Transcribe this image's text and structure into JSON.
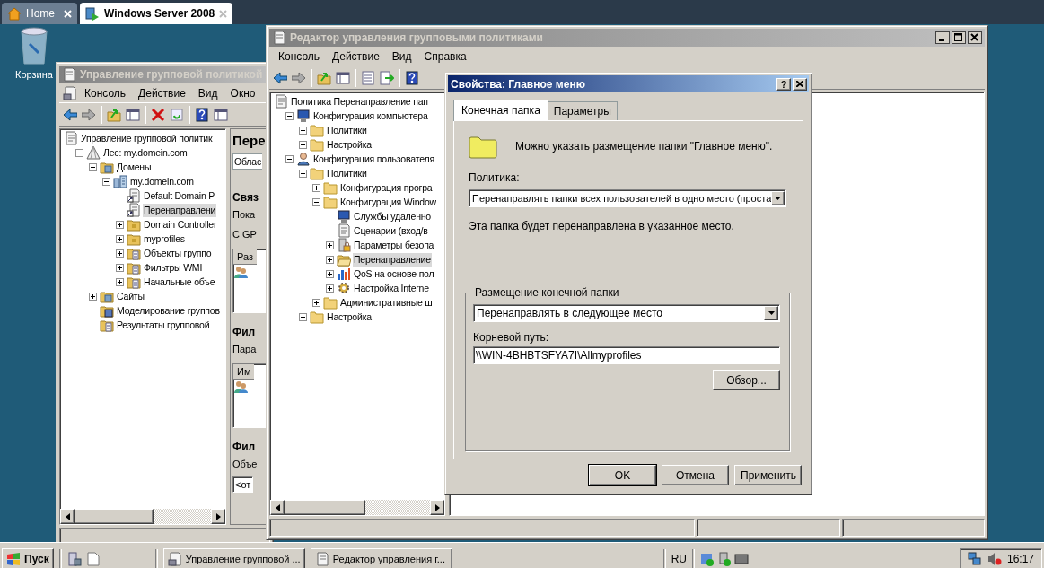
{
  "browser_tabs": [
    {
      "label": "Home",
      "selected": false
    },
    {
      "label": "Windows Server 2008",
      "selected": true
    }
  ],
  "desktop_icons": [
    {
      "label": "Корзина"
    }
  ],
  "gpmc_window": {
    "title": "Управление групповой политикой",
    "active": false,
    "menu": [
      "Консоль",
      "Действие",
      "Вид",
      "Окно"
    ],
    "tree": [
      {
        "label": "Управление групповой политик",
        "kind": "console",
        "selected": false,
        "children": [
          {
            "label": "Лес: my.domein.com",
            "kind": "forest",
            "expanded": true,
            "selected": false,
            "children": [
              {
                "label": "Домены",
                "kind": "domains",
                "expanded": true,
                "selected": false,
                "children": [
                  {
                    "label": "my.domein.com",
                    "kind": "domain",
                    "expanded": true,
                    "selected": false,
                    "children": [
                      {
                        "label": "Default Domain P",
                        "kind": "link",
                        "selected": false
                      },
                      {
                        "label": "Перенаправлени",
                        "kind": "link",
                        "selected": true
                      },
                      {
                        "label": "Domain Controller",
                        "kind": "ou",
                        "expanded": false,
                        "selected": false
                      },
                      {
                        "label": "myprofiles",
                        "kind": "ou",
                        "expanded": false,
                        "selected": false
                      },
                      {
                        "label": "Объекты группо",
                        "kind": "folder-doc",
                        "expanded": false,
                        "selected": false
                      },
                      {
                        "label": "Фильтры WMI",
                        "kind": "folder-doc",
                        "expanded": false,
                        "selected": false
                      },
                      {
                        "label": "Начальные объе",
                        "kind": "folder-doc",
                        "expanded": false,
                        "selected": false
                      }
                    ]
                  }
                ]
              },
              {
                "label": "Сайты",
                "kind": "domains",
                "expanded": false,
                "selected": false
              },
              {
                "label": "Моделирование группов",
                "kind": "modeling",
                "selected": false
              },
              {
                "label": "Результаты групповой",
                "kind": "folder-doc",
                "selected": false
              }
            ]
          }
        ]
      }
    ],
    "details": [
      {
        "kind": "title",
        "text": "Пере"
      },
      {
        "kind": "tab",
        "text": "Облас"
      },
      {
        "kind": "bold",
        "text": "Связ"
      },
      {
        "kind": "text",
        "text": "Пока"
      },
      {
        "kind": "text",
        "text": "С GP"
      },
      {
        "kind": "list",
        "text": "Раз"
      },
      {
        "kind": "bold",
        "text": "Фил"
      },
      {
        "kind": "text",
        "text": "Пара"
      },
      {
        "kind": "list",
        "text": "Им"
      },
      {
        "kind": "bold",
        "text": "Фил"
      },
      {
        "kind": "text",
        "text": "Объе"
      },
      {
        "kind": "field",
        "text": "<от"
      }
    ]
  },
  "editor_window": {
    "title": "Редактор управления групповыми политиками",
    "active": false,
    "menu": [
      "Консоль",
      "Действие",
      "Вид",
      "Справка"
    ],
    "tree": [
      {
        "label": "Политика Перенаправление пап",
        "kind": "console",
        "selected": false,
        "children": [
          {
            "label": "Конфигурация компьютера",
            "kind": "computer",
            "expanded": true,
            "selected": false,
            "children": [
              {
                "label": "Политики",
                "kind": "folder",
                "expanded": false,
                "selected": false
              },
              {
                "label": "Настройка",
                "kind": "folder",
                "expanded": false,
                "selected": false
              }
            ]
          },
          {
            "label": "Конфигурация пользователя",
            "kind": "user",
            "expanded": true,
            "selected": false,
            "children": [
              {
                "label": "Политики",
                "kind": "folder",
                "expanded": true,
                "selected": false,
                "children": [
                  {
                    "label": "Конфигурация програ",
                    "kind": "folder",
                    "expanded": false,
                    "selected": false
                  },
                  {
                    "label": "Конфигурация Window",
                    "kind": "folder",
                    "expanded": true,
                    "selected": false,
                    "children": [
                      {
                        "label": "Службы удаленно",
                        "kind": "computer",
                        "selected": false
                      },
                      {
                        "label": "Сценарии (вход/в",
                        "kind": "console",
                        "selected": false
                      },
                      {
                        "label": "Параметры безопа",
                        "kind": "security",
                        "expanded": false,
                        "selected": false
                      },
                      {
                        "label": "Перенаправление",
                        "kind": "folder-open",
                        "expanded": false,
                        "selected": true
                      },
                      {
                        "label": "QoS на основе пол",
                        "kind": "chart",
                        "expanded": false,
                        "selected": false
                      },
                      {
                        "label": "Настройка Interne",
                        "kind": "settings",
                        "expanded": false,
                        "selected": false
                      }
                    ]
                  },
                  {
                    "label": "Административные ш",
                    "kind": "folder",
                    "expanded": false,
                    "selected": false
                  }
                ]
              },
              {
                "label": "Настройка",
                "kind": "folder",
                "expanded": false,
                "selected": false
              }
            ]
          }
        ]
      }
    ]
  },
  "dialog": {
    "title": "Свойства: Главное меню",
    "active": true,
    "help_button": "?",
    "tabs": [
      {
        "label": "Конечная папка",
        "selected": true
      },
      {
        "label": "Параметры",
        "selected": false
      }
    ],
    "intro": "Можно указать размещение папки \"Главное меню\".",
    "policy_label": "Политика:",
    "policy_value": "Перенаправлять папки всех пользователей в одно место (проста",
    "policy_note": "Эта папка будет перенаправлена в указанное место.",
    "group_title": "Размещение конечной папки",
    "location_value": "Перенаправлять в следующее место",
    "root_path_label": "Корневой путь:",
    "root_path_value": "\\\\WIN-4BHBTSFYA7I\\Allmyprofiles",
    "browse_button": "Обзор...",
    "buttons": [
      {
        "label": "OK",
        "default": true
      },
      {
        "label": "Отмена",
        "default": false
      },
      {
        "label": "Применить",
        "default": false
      }
    ]
  },
  "taskbar": {
    "start_label": "Пуск",
    "tasks": [
      {
        "label": "Управление групповой ...",
        "selected": false
      },
      {
        "label": "Редактор управления г...",
        "selected": false
      }
    ],
    "language": "RU",
    "clock": "16:17"
  }
}
